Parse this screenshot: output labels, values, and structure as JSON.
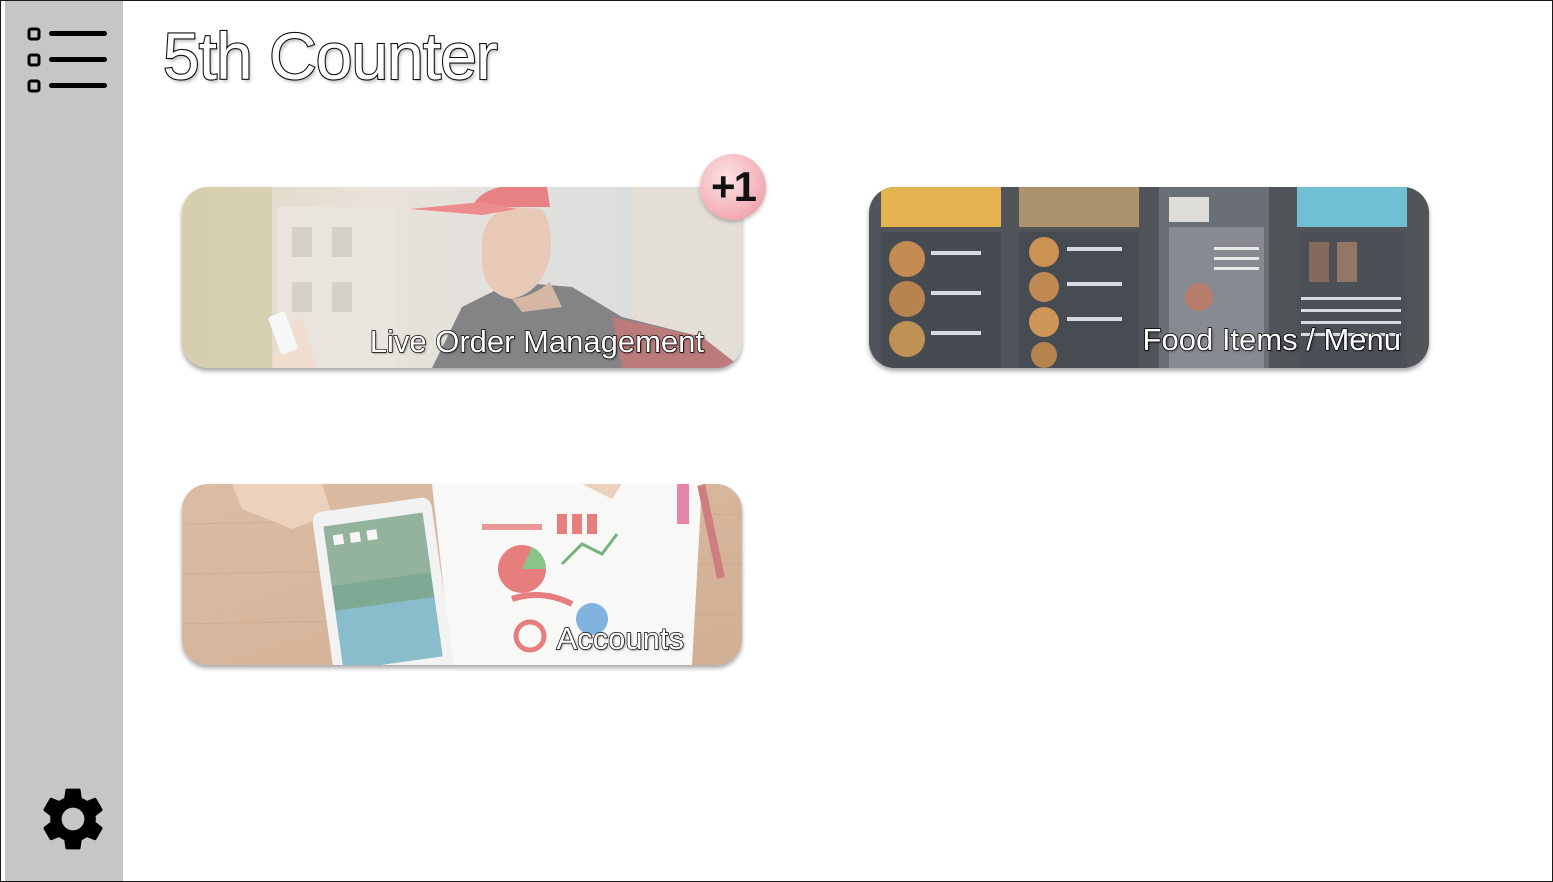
{
  "app": {
    "title": "5th Counter"
  },
  "sidebar": {
    "menu_icon": "list-icon",
    "settings_icon": "gear-icon"
  },
  "cards": [
    {
      "id": "live-order-management",
      "label": "Live Order Management",
      "badge": "+1",
      "image": "delivery-man-with-phone"
    },
    {
      "id": "food-items-menu",
      "label": "Food Items / Menu",
      "image": "fast-food-menu-boards"
    },
    {
      "id": "accounts",
      "label": "Accounts",
      "image": "tablet-and-charts-on-desk"
    }
  ],
  "colors": {
    "sidebar": "#c6c6c6",
    "background": "#ffffff",
    "badge": "#f4b4bb"
  }
}
